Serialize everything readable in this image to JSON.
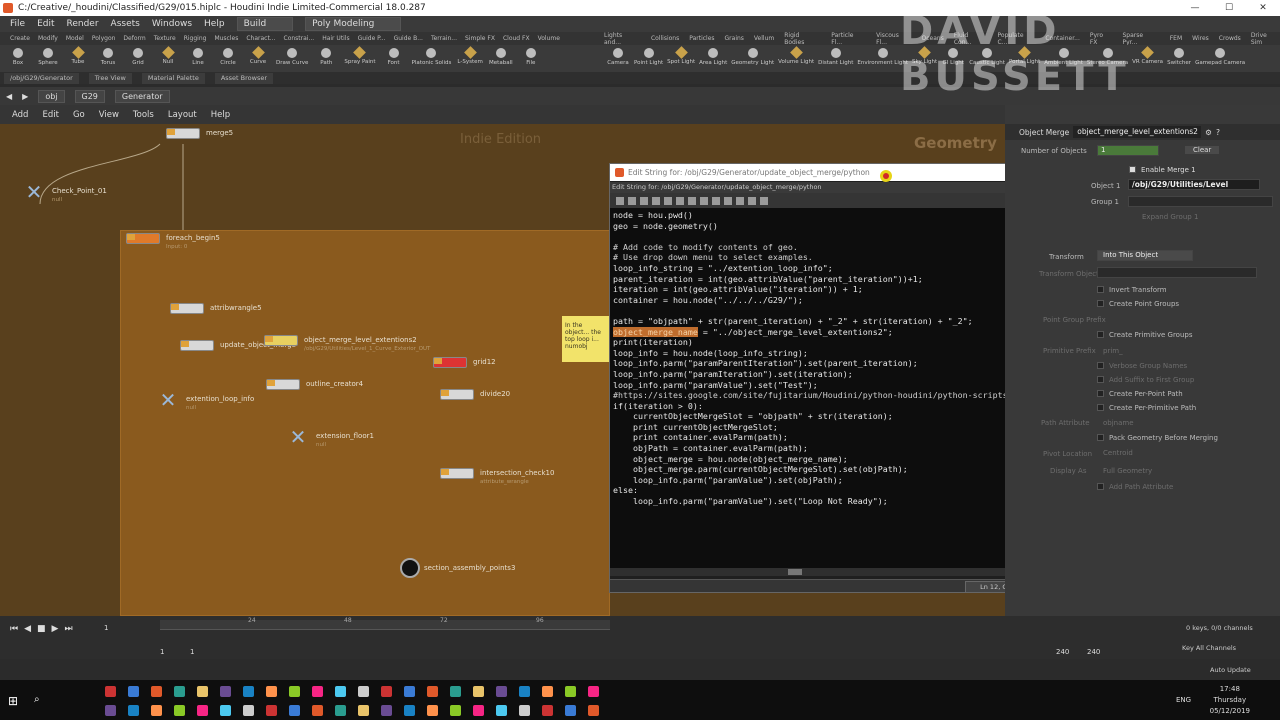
{
  "window": {
    "title": "C:/Creative/_houdini/Classified/G29/015.hiplc - Houdini Indie Limited-Commercial 18.0.287",
    "minimize": "—",
    "maximize": "☐",
    "close": "✕"
  },
  "menubar": {
    "items": [
      "File",
      "Edit",
      "Render",
      "Assets",
      "Windows",
      "Help"
    ],
    "build": "Build",
    "desktop": "Poly Modeling"
  },
  "shelf": {
    "tabs": [
      "Create",
      "Modify",
      "Model",
      "Polygon",
      "Deform",
      "Texture",
      "Rigging",
      "Muscles",
      "Charact...",
      "Constrai...",
      "Hair Utils",
      "Guide P...",
      "Guide B...",
      "Terrain...",
      "Simple FX",
      "Cloud FX",
      "Volume"
    ],
    "tools": [
      "Box",
      "Sphere",
      "Tube",
      "Torus",
      "Grid",
      "Null",
      "Line",
      "Circle",
      "Curve",
      "Draw Curve",
      "Path",
      "Spray Paint",
      "Font",
      "Platonic Solids",
      "L-System",
      "Metaball",
      "File"
    ],
    "tabs2": [
      "Lights and...",
      "Collisions",
      "Particles",
      "Grains",
      "Vellum",
      "Rigid Bodies",
      "Particle Fl...",
      "Viscous Fl...",
      "Oceans",
      "Fluid Con...",
      "Populate C...",
      "Container...",
      "Pyro FX",
      "Sparse Pyr...",
      "FEM",
      "Wires",
      "Crowds",
      "Drive Sim"
    ],
    "tools2": [
      "Camera",
      "Point Light",
      "Spot Light",
      "Area Light",
      "Geometry Light",
      "Volume Light",
      "Distant Light",
      "Environment Light",
      "Sky Light",
      "GI Light",
      "Caustic Light",
      "Portal Light",
      "Ambient Light",
      "Stereo Camera",
      "VR Camera",
      "Switcher",
      "Gamepad Camera"
    ]
  },
  "panetabs": [
    "/obj/G29/Generator",
    "Tree View",
    "Material Palette",
    "Asset Browser"
  ],
  "path": {
    "back": "◀",
    "forward": "▶",
    "obj": "obj",
    "g29": "G29",
    "gen": "Generator"
  },
  "netmenu": [
    "Add",
    "Edit",
    "Go",
    "View",
    "Tools",
    "Layout",
    "Help"
  ],
  "network": {
    "indie": "Indie Edition",
    "context": "Geometry",
    "nodes": [
      {
        "name": "merge5",
        "sub": ""
      },
      {
        "name": "Check_Point_01",
        "sub": "null"
      },
      {
        "name": "foreach_begin5",
        "sub": "Input: 0"
      },
      {
        "name": "attribwrangle5",
        "sub": ""
      },
      {
        "name": "update_object_merge",
        "sub": ""
      },
      {
        "name": "object_merge_level_extentions2",
        "sub": "/obj/G29/Utilities/Level_1_Curve_Exterior_OUT"
      },
      {
        "name": "grid12",
        "sub": ""
      },
      {
        "name": "extention_loop_info",
        "sub": "null"
      },
      {
        "name": "outline_creator4",
        "sub": ""
      },
      {
        "name": "divide20",
        "sub": ""
      },
      {
        "name": "extension_floor1",
        "sub": "null"
      },
      {
        "name": "intersection_check10",
        "sub": "attribute_wrangle"
      },
      {
        "name": "section_assembly_points3",
        "sub": ""
      }
    ],
    "sticky": "In the object... the top loop i... numobj"
  },
  "editor": {
    "title": "Edit String for: /obj/G29/Generator/update_object_merge/python",
    "subtitle": "Edit String for: /obj/G29/Generator/update_object_merge/python",
    "close": "✕",
    "status": "Ln 12, Col 18",
    "lines": [
      "node = hou.pwd()",
      "geo = node.geometry()",
      "",
      "# Add code to modify contents of geo.",
      "# Use drop down menu to select examples.",
      "loop_info_string = \"../extention_loop_info\";",
      "parent_iteration = int(geo.attribValue(\"parent_iteration\"))+1;",
      "iteration = int(geo.attribValue(\"iteration\")) + 1;",
      "container = hou.node(\"../../../G29/\");",
      "",
      "path = \"objpath\" + str(parent_iteration) + \"_2\" + str(iteration) + \"_2\";",
      "object_merge_name = \"../object_merge_level_extentions2\";",
      "print(iteration)",
      "loop_info = hou.node(loop_info_string);",
      "loop_info.parm(\"paramParentIteration\").set(parent_iteration);",
      "loop_info.parm(\"paramIteration\").set(iteration);",
      "loop_info.parm(\"paramValue\").set(\"Test\");",
      "#https://sites.google.com/site/fujitarium/Houdini/python-houdini/python-scripts-houdini",
      "if(iteration > 0):",
      "    currentObjectMergeSlot = \"objpath\" + str(iteration);",
      "    print currentObjectMergeSlot;",
      "    print container.evalParm(path);",
      "    objPath = container.evalParm(path);",
      "    object_merge = hou.node(object_merge_name);",
      "    object_merge.parm(currentObjectMergeSlot).set(objPath);",
      "    loop_info.parm(\"paramValue\").set(objPath);",
      "else:",
      "    loop_info.parm(\"paramValue\").set(\"Loop Not Ready\");"
    ]
  },
  "params": {
    "type": "Object Merge",
    "node": "object_merge_level_extentions2",
    "number_of_objects_label": "Number of Objects",
    "number_of_objects": "1",
    "clear": "Clear",
    "enable_merge": "Enable Merge 1",
    "object1_label": "Object 1",
    "object1": "/obj/G29/Utilities/Level",
    "group1_label": "Group 1",
    "expand_group": "Expand Group 1",
    "transform_label": "Transform",
    "transform_value": "Into This Object",
    "transform_object": "Transform Object",
    "invert_transform": "Invert Transform",
    "create_point_groups": "Create Point Groups",
    "point_group_prefix": "Point Group Prefix",
    "create_primitive_groups": "Create Primitive Groups",
    "prim_group_prefix": "Primitive Prefix",
    "prim_prefix_value": "prim_",
    "verbose_group_names": "Verbose Group Names",
    "add_suffix": "Add Suffix to First Group",
    "create_per_point_path": "Create Per-Point Path",
    "create_per_primitive_path": "Create Per-Primitive Path",
    "path_attribute": "Path Attribute",
    "path_attribute_value": "objname",
    "pack_geometry": "Pack Geometry Before Merging",
    "pivot_location": "Pivot Location",
    "pivot_value": "Centroid",
    "display_as": "Display As",
    "display_value": "Full Geometry",
    "add_path_attribute": "Add Path Attribute"
  },
  "timeline": {
    "frame": "1",
    "start": "1",
    "startb": "1",
    "ticks": [
      "24",
      "48",
      "72",
      "96"
    ],
    "end": "240",
    "endb": "240",
    "keys": "0 keys, 0/0 channels",
    "key_all": "Key All Channels",
    "auto_update": "Auto Update"
  },
  "taskbar": {
    "lang": "ENG",
    "time": "17:48",
    "day": "Thursday",
    "date": "05/12/2019"
  },
  "watermark": "DAVID BUSSETT"
}
